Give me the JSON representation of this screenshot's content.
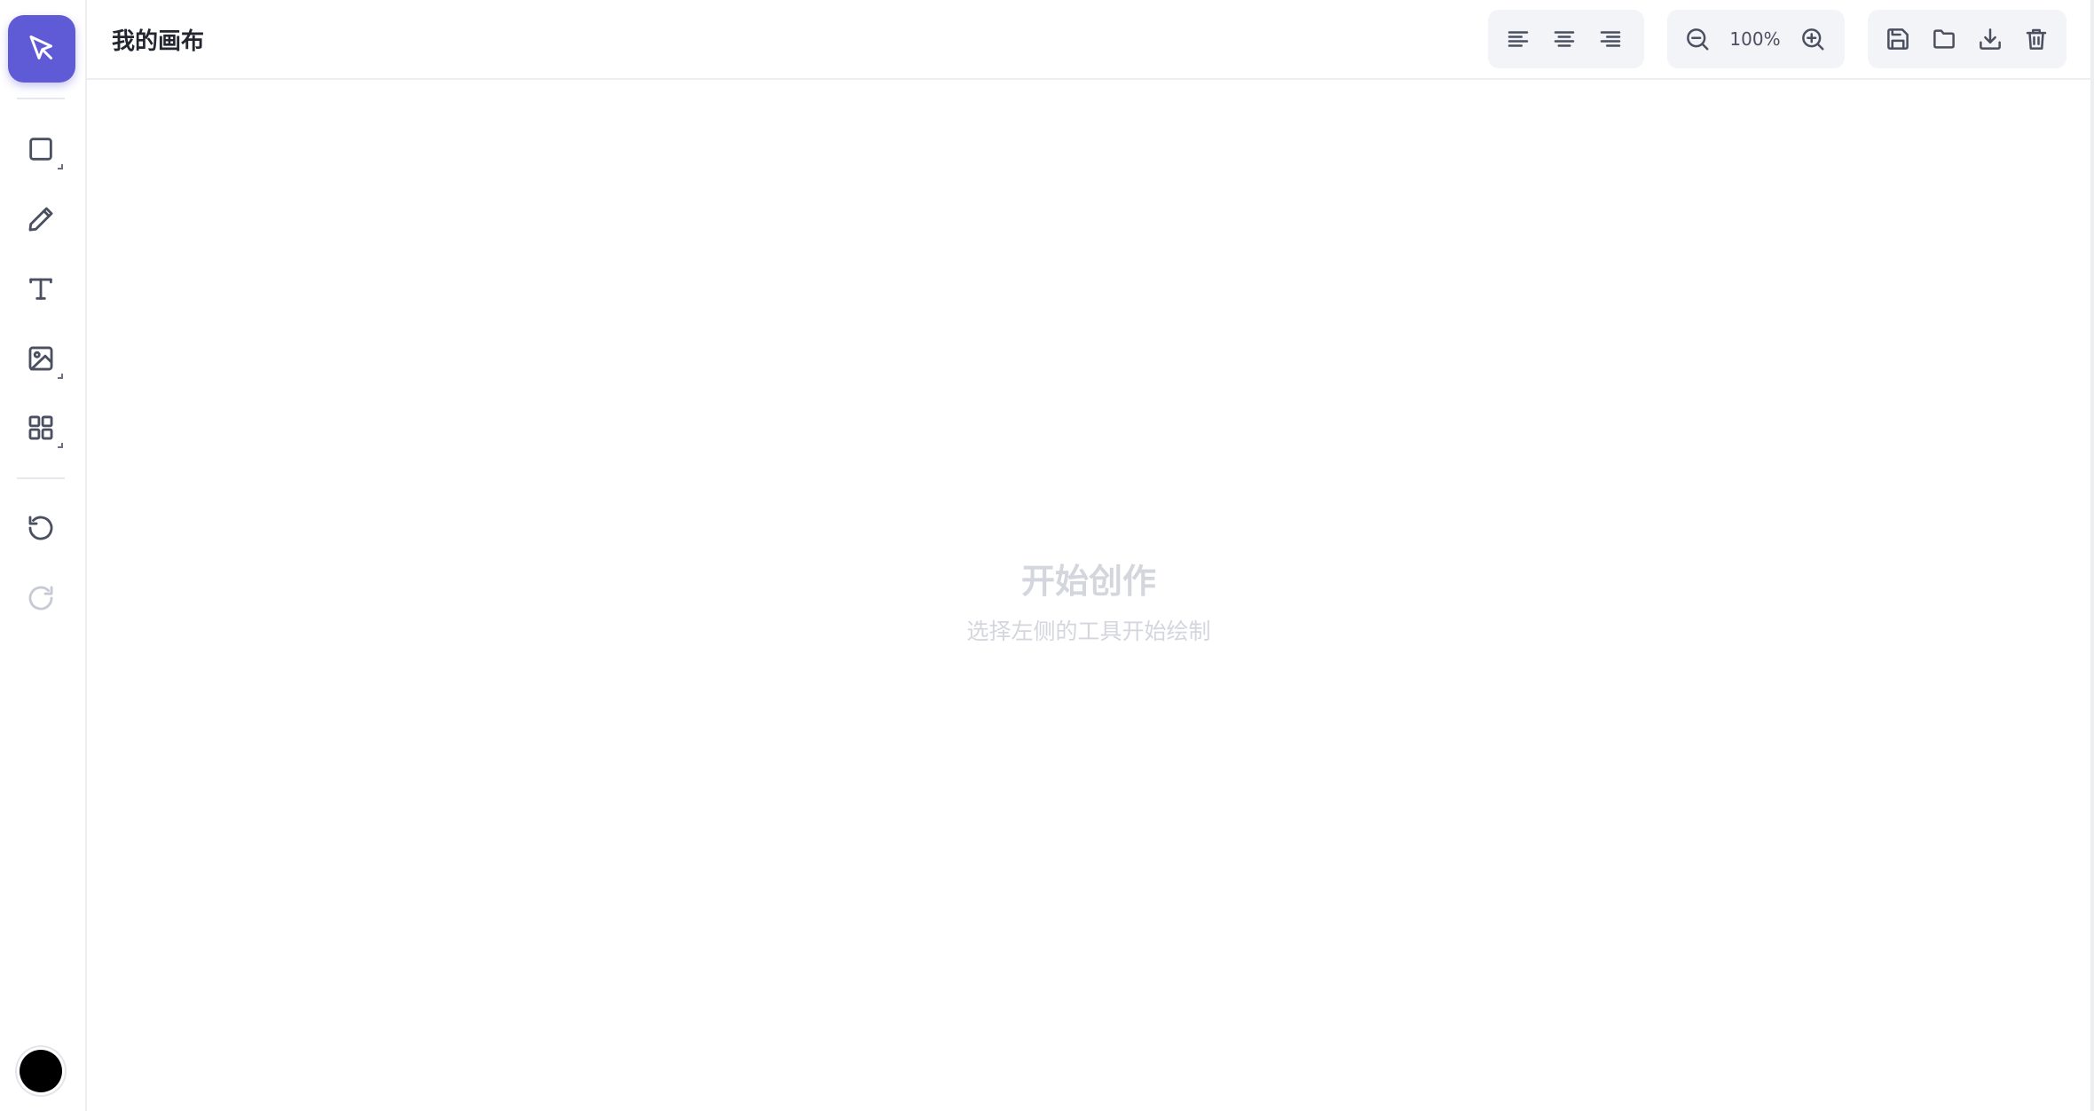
{
  "header": {
    "title": "我的画布",
    "zoom": "100%"
  },
  "canvas": {
    "empty_title": "开始创作",
    "empty_subtitle": "选择左侧的工具开始绘制"
  },
  "sidebar": {
    "tools": [
      {
        "name": "select",
        "icon": "cursor-arrow-icon",
        "active": true
      },
      {
        "name": "shape",
        "icon": "square-icon"
      },
      {
        "name": "pen",
        "icon": "pencil-icon"
      },
      {
        "name": "text",
        "icon": "text-icon"
      },
      {
        "name": "image",
        "icon": "image-icon"
      },
      {
        "name": "components",
        "icon": "grid-icon"
      },
      {
        "name": "undo",
        "icon": "undo-icon"
      },
      {
        "name": "redo",
        "icon": "redo-icon",
        "disabled": true
      }
    ],
    "current_color": "#000000"
  },
  "colors": {
    "accent": "#5f5bd6",
    "icon": "#4b5060",
    "placeholder_text": "#d4d6dd"
  }
}
